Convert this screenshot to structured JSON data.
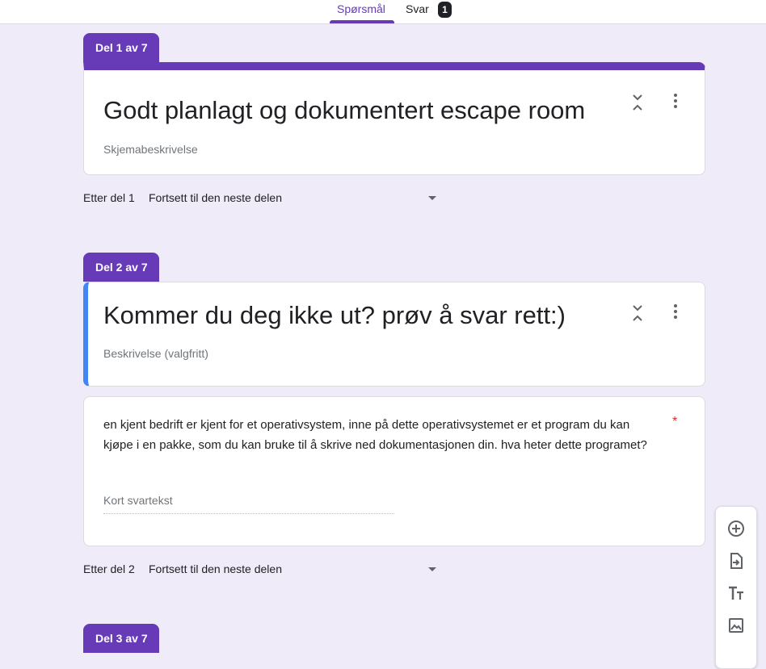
{
  "tabs": {
    "questions_label": "Spørsmål",
    "answers_label": "Svar",
    "answers_count": "1"
  },
  "sections": [
    {
      "label": "Del 1 av 7",
      "title": "Godt planlagt og dokumentert escape room",
      "description": "Skjemabeskrivelse",
      "after_label": "Etter del 1",
      "after_value": "Fortsett til den neste delen"
    },
    {
      "label": "Del 2 av 7",
      "title": "Kommer du deg ikke ut? prøv å svar rett:)",
      "description": "Beskrivelse (valgfritt)",
      "after_label": "Etter del 2",
      "after_value": "Fortsett til den neste delen"
    },
    {
      "label": "Del 3 av 7"
    }
  ],
  "question": {
    "text": "en kjent bedrift er kjent for et operativsystem, inne på dette operativsystemet er et program du kan kjøpe i en pakke, som du kan bruke til å skrive ned dokumentasjonen din. hva heter dette programet?",
    "required_mark": "*",
    "answer_placeholder": "Kort svartekst"
  },
  "toolbar": [
    "add-question-icon",
    "import-questions-icon",
    "add-title-icon",
    "add-image-icon"
  ],
  "colors": {
    "accent": "#673ab7",
    "background": "#f0ebf8",
    "active_section": "#4285f4",
    "required": "#d93025"
  }
}
